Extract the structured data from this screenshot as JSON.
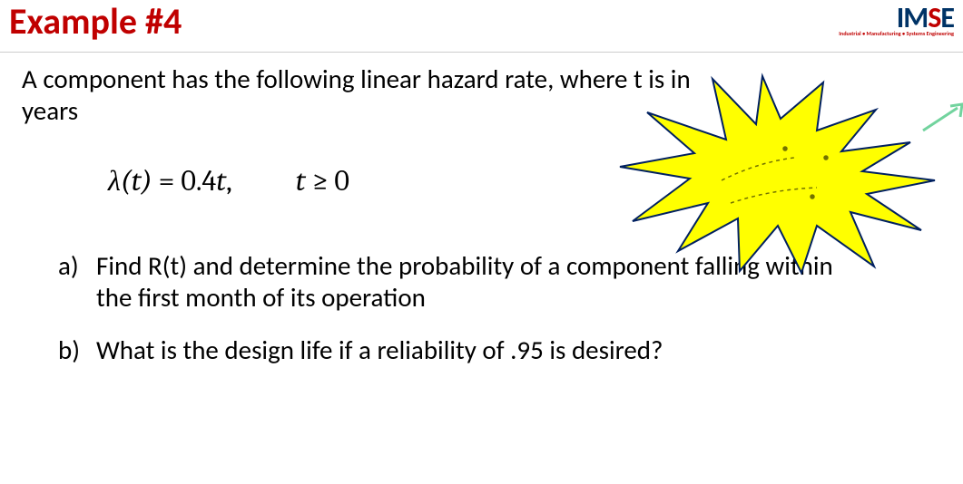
{
  "header": {
    "title": "Example #4",
    "logo": {
      "text_im": "IM",
      "text_s": "S",
      "text_e": "E",
      "subtitle": "Industrial • Manufacturing • Systems Engineering"
    }
  },
  "intro": "A component has the following linear hazard rate, where t is in years",
  "formula": {
    "lhs": "λ(t) = 0.4t,",
    "rhs": "t ≥ 0"
  },
  "questions": {
    "a": {
      "label": "a)",
      "text": "Find R(t) and determine the probability of a component falling within the first month of its operation"
    },
    "b": {
      "label": "b)",
      "text": "What is the design life if a reliability of .95 is desired?"
    }
  }
}
